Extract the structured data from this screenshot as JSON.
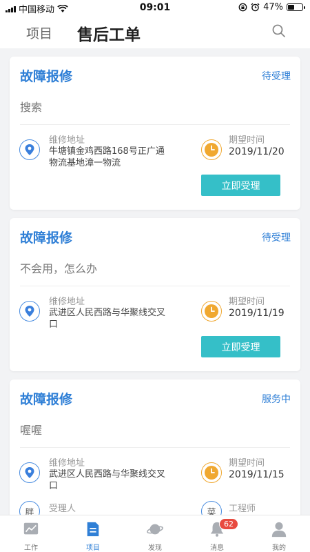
{
  "status_bar": {
    "carrier": "中国移动",
    "time": "09:01",
    "battery": "47%",
    "battery_level": 0.47
  },
  "navbar": {
    "project_label": "项目",
    "title": "售后工单"
  },
  "cards": [
    {
      "title": "故障报修",
      "status": "待受理",
      "description": "搜索",
      "address_label": "维修地址",
      "address": "牛塘镇金鸡西路168号正广通物流基地漳一物流",
      "time_label": "期望时间",
      "time": "2019/11/20",
      "button_label": "立即受理"
    },
    {
      "title": "故障报修",
      "status": "待受理",
      "description": "不会用，怎么办",
      "address_label": "维修地址",
      "address": "武进区人民西路与华聚线交叉口",
      "time_label": "期望时间",
      "time": "2019/11/19",
      "button_label": "立即受理"
    },
    {
      "title": "故障报修",
      "status": "服务中",
      "description": "喔喔",
      "address_label": "维修地址",
      "address": "武进区人民西路与华聚线交叉口",
      "time_label": "期望时间",
      "time": "2019/11/15",
      "acceptor_label": "受理人",
      "acceptor_avatar": "胖",
      "engineer_label": "工程师",
      "engineer_avatar": "菜"
    }
  ],
  "tabbar": {
    "tabs": [
      {
        "label": "工作",
        "icon": "chart-icon"
      },
      {
        "label": "项目",
        "icon": "document-icon"
      },
      {
        "label": "发现",
        "icon": "planet-icon"
      },
      {
        "label": "消息",
        "icon": "bell-icon"
      },
      {
        "label": "我的",
        "icon": "person-icon"
      }
    ],
    "active_tab": "项目",
    "message_badge": "62"
  },
  "colors": {
    "accent_blue": "#2f7fd6",
    "button_teal": "#35bfc8",
    "clock_orange": "#f0a830",
    "badge_red": "#e84a3f"
  }
}
